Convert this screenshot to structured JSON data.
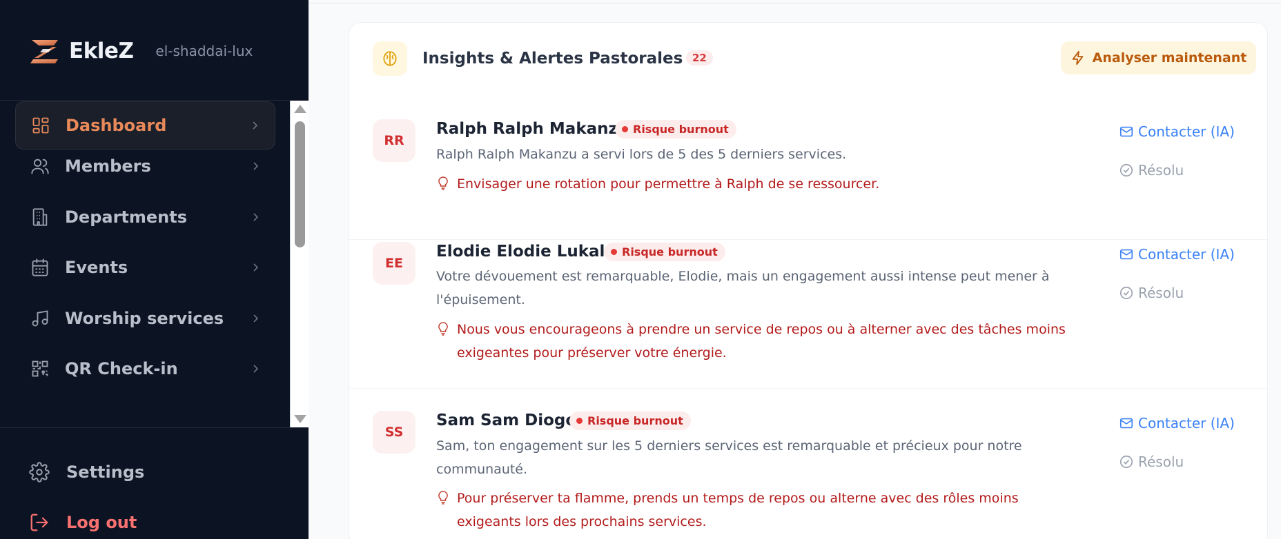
{
  "brand": {
    "name": "EkleZ",
    "slug": "el-shaddai-lux"
  },
  "nav": {
    "items": [
      {
        "label": "Dashboard",
        "icon": "dashboard-icon",
        "active": true
      },
      {
        "label": "Members",
        "icon": "users-icon",
        "active": false
      },
      {
        "label": "Departments",
        "icon": "building-icon",
        "active": false
      },
      {
        "label": "Events",
        "icon": "calendar-icon",
        "active": false
      },
      {
        "label": "Worship services",
        "icon": "music-note-icon",
        "active": false
      },
      {
        "label": "QR Check-in",
        "icon": "qr-code-icon",
        "active": false
      }
    ],
    "settings_label": "Settings",
    "logout_label": "Log out"
  },
  "insights": {
    "title": "Insights & Alertes Pastorales",
    "count": "22",
    "analyze_label": "Analyser maintenant",
    "contact_label": "Contacter (IA)",
    "resolve_label": "Résolu",
    "alerts": [
      {
        "initials": "RR",
        "name": "Ralph Ralph Makanzu",
        "badge": "Risque burnout",
        "message": "Ralph Ralph Makanzu a servi lors de 5 des 5 derniers services.",
        "tip": "Envisager une rotation pour permettre à Ralph de se ressourcer."
      },
      {
        "initials": "EE",
        "name": "Elodie Elodie Lukala",
        "badge": "Risque burnout",
        "message": "Votre dévouement est remarquable, Elodie, mais un engagement aussi intense peut mener à l'épuisement.",
        "tip": "Nous vous encourageons à prendre un service de repos ou à alterner avec des tâches moins exigeantes pour préserver votre énergie."
      },
      {
        "initials": "SS",
        "name": "Sam Sam Diogo",
        "badge": "Risque burnout",
        "message": "Sam, ton engagement sur les 5 derniers services est remarquable et précieux pour notre communauté.",
        "tip": "Pour préserver ta flamme, prends un temps de repos ou alterne avec des rôles moins exigeants lors des prochains services."
      }
    ]
  },
  "colors": {
    "sidebar_bg": "#0c1322",
    "accent": "#e8895a",
    "logout": "#f87171",
    "danger": "#d12f2f",
    "link": "#3b82f6",
    "warning_bg": "#fef5de"
  }
}
